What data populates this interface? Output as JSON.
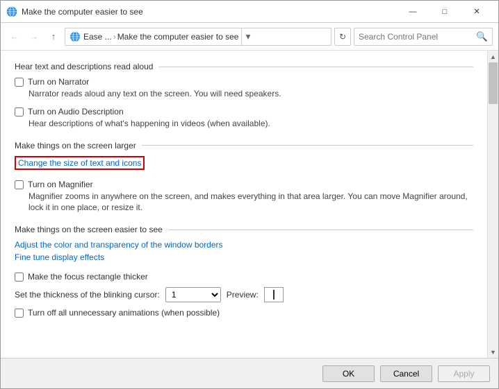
{
  "window": {
    "title": "Make the computer easier to see",
    "controls": {
      "minimize": "—",
      "maximize": "□",
      "close": "✕"
    }
  },
  "nav": {
    "back_disabled": true,
    "forward_disabled": true,
    "up_label": "↑",
    "breadcrumb_prefix": "Ease ...",
    "breadcrumb_sep": "›",
    "breadcrumb_page": "Make the computer easier to see",
    "search_placeholder": "Search Control Panel"
  },
  "sections": {
    "hear_text": {
      "title": "Hear text and descriptions read aloud",
      "narrator": {
        "label": "Turn on Narrator",
        "description": "Narrator reads aloud any text on the screen. You will need speakers.",
        "checked": false
      },
      "audio_description": {
        "label": "Turn on Audio Description",
        "description": "Hear descriptions of what's happening in videos (when available).",
        "checked": false
      }
    },
    "make_larger": {
      "title": "Make things on the screen larger",
      "change_link": "Change the size of text and icons",
      "magnifier": {
        "label": "Turn on Magnifier",
        "description": "Magnifier zooms in anywhere on the screen, and makes everything in that area larger. You can move Magnifier around, lock it in one place, or resize it.",
        "checked": false
      }
    },
    "easier_to_see": {
      "title": "Make things on the screen easier to see",
      "link1": "Adjust the color and transparency of the window borders",
      "link2": "Fine tune display effects",
      "focus_checkbox": {
        "label": "Make the focus rectangle thicker",
        "checked": false
      },
      "cursor": {
        "label": "Set the thickness of the blinking cursor:",
        "value": "1",
        "preview_label": "Preview:"
      },
      "animations": {
        "label": "Turn off all unnecessary animations (when possible)",
        "checked": false
      }
    }
  },
  "footer": {
    "ok": "OK",
    "cancel": "Cancel",
    "apply": "Apply"
  }
}
